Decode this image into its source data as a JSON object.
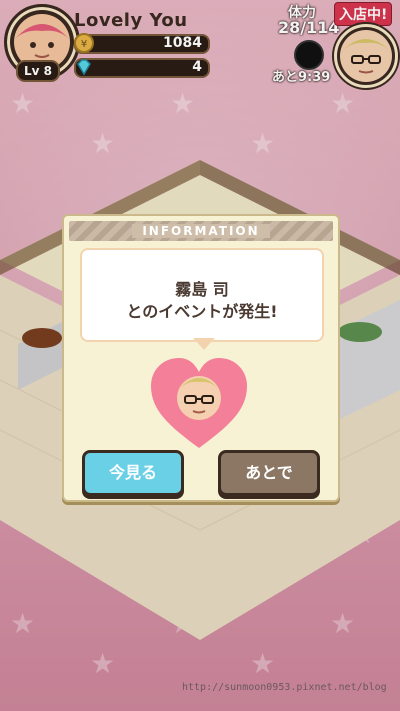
{
  "player": {
    "name": "Lovely You",
    "level": "Lv 8",
    "coins": "1084",
    "gems": "4"
  },
  "stamina": {
    "label": "体力",
    "value": "28/114",
    "timer": "あと9:39"
  },
  "store": {
    "status_label": "入店中!"
  },
  "modal": {
    "title": "INFORMATION",
    "character_name": "霧島 司",
    "message": "とのイベントが発生!",
    "primary_button": "今見る",
    "secondary_button": "あとで"
  },
  "watermark": "http://sunmoon0953.pixnet.net/blog",
  "colors": {
    "accent_pink": "#e35b78",
    "button_primary": "#6ad0e6",
    "button_secondary": "#8b7764",
    "hud_dark": "#2a1d16"
  },
  "icons": {
    "coin": "coin-icon",
    "gem": "gem-icon",
    "heart": "heart-icon"
  }
}
